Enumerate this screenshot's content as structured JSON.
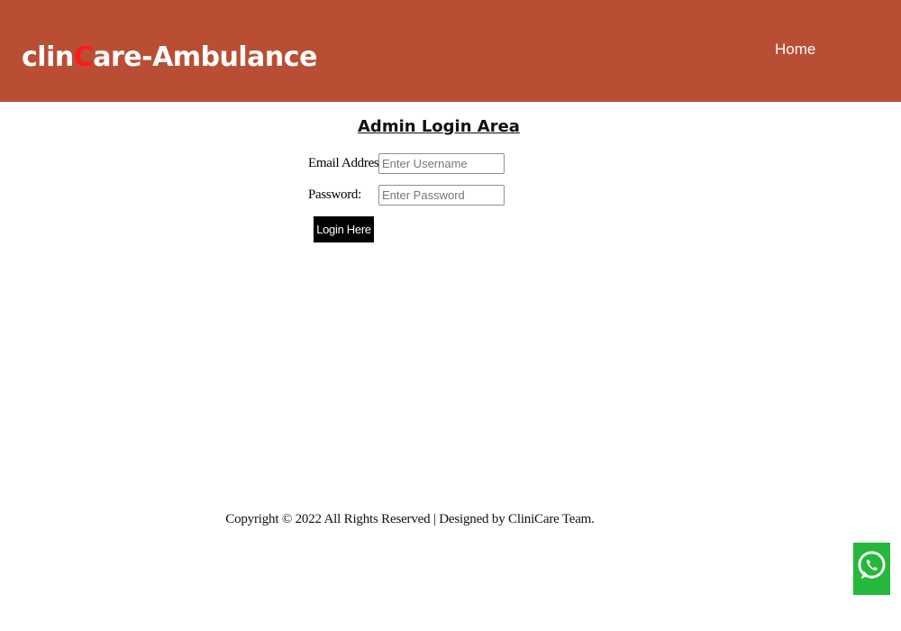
{
  "header": {
    "brand_prefix": "clin",
    "brand_accent": "C",
    "brand_suffix": "are-Ambulance",
    "nav_home": "Home",
    "bg_color": "#b94e34",
    "accent_color": "#ff1a1a"
  },
  "login": {
    "title": "Admin Login Area",
    "email_label": "Email Address:",
    "email_placeholder": "Enter Username",
    "email_value": "",
    "password_label": "Password:",
    "password_placeholder": "Enter Password",
    "password_value": "",
    "submit_label": "Login Here"
  },
  "footer": {
    "copyright": "Copyright © 2022 All Rights Reserved | Designed by CliniCare Team."
  },
  "floating": {
    "whatsapp_icon": "whatsapp-icon",
    "whatsapp_color": "#25b83a"
  }
}
